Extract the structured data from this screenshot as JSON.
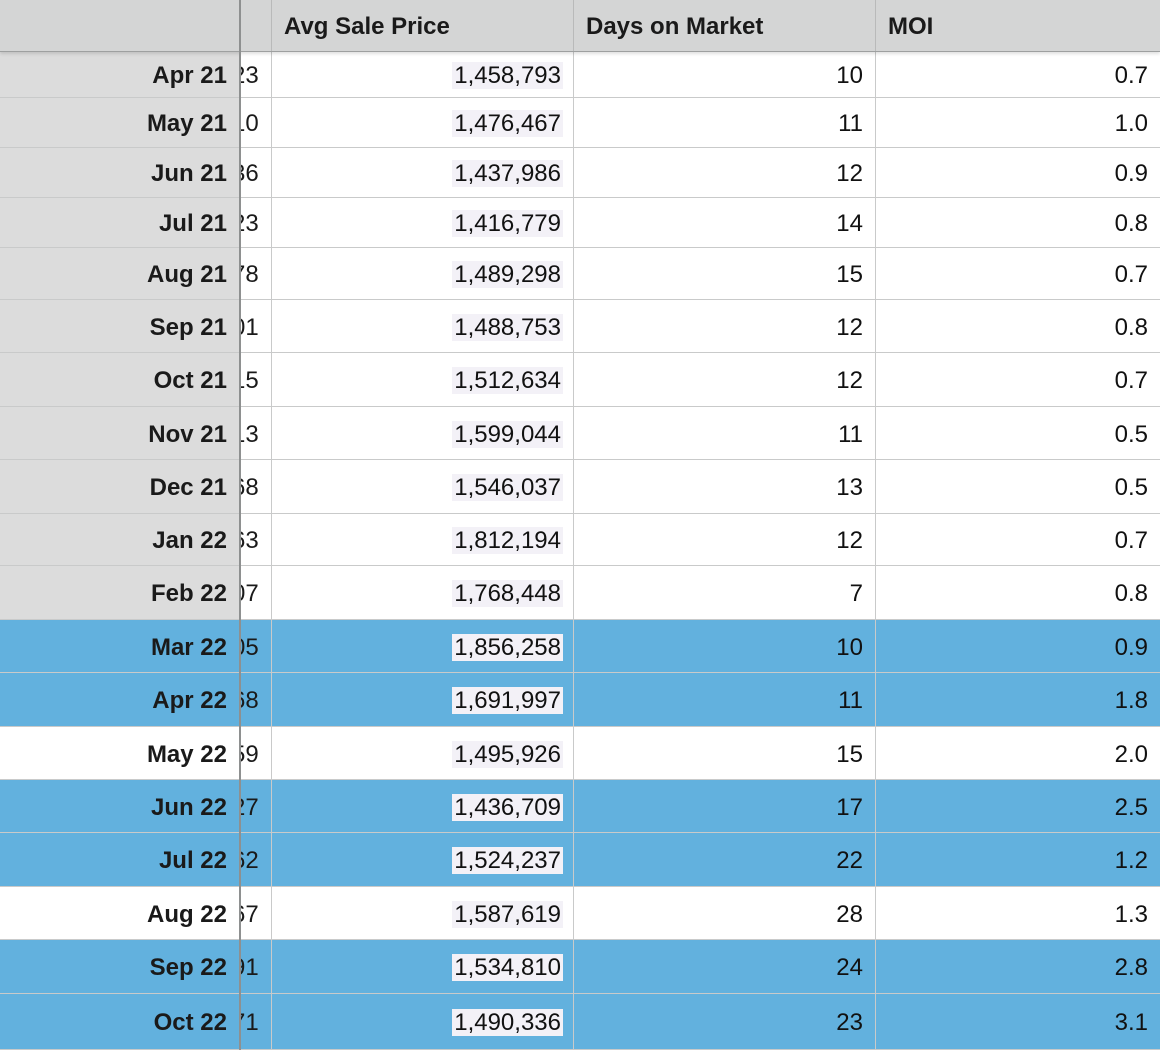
{
  "colors": {
    "header_bg": "#d4d5d5",
    "frozen_bg": "#dcdcdc",
    "highlight_blue": "#62b1de",
    "price_cell_bg": "#f3f1f7"
  },
  "header": {
    "col0": "",
    "col1": "",
    "col2": "Avg Sale Price",
    "col3": "Days on Market",
    "col4": "MOI"
  },
  "rows": [
    {
      "month": "Apr 21",
      "cut": "23",
      "price": "1,458,793",
      "dom": "10",
      "moi": "0.7",
      "style": "gray"
    },
    {
      "month": "May 21",
      "cut": "10",
      "price": "1,476,467",
      "dom": "11",
      "moi": "1.0",
      "style": "gray"
    },
    {
      "month": "Jun 21",
      "cut": "36",
      "price": "1,437,986",
      "dom": "12",
      "moi": "0.9",
      "style": "gray"
    },
    {
      "month": "Jul 21",
      "cut": "23",
      "price": "1,416,779",
      "dom": "14",
      "moi": "0.8",
      "style": "gray"
    },
    {
      "month": "Aug 21",
      "cut": "78",
      "price": "1,489,298",
      "dom": "15",
      "moi": "0.7",
      "style": "gray"
    },
    {
      "month": "Sep 21",
      "cut": "01",
      "price": "1,488,753",
      "dom": "12",
      "moi": "0.8",
      "style": "gray"
    },
    {
      "month": "Oct 21",
      "cut": "15",
      "price": "1,512,634",
      "dom": "12",
      "moi": "0.7",
      "style": "gray"
    },
    {
      "month": "Nov 21",
      "cut": "13",
      "price": "1,599,044",
      "dom": "11",
      "moi": "0.5",
      "style": "gray"
    },
    {
      "month": "Dec 21",
      "cut": "68",
      "price": "1,546,037",
      "dom": "13",
      "moi": "0.5",
      "style": "gray"
    },
    {
      "month": "Jan 22",
      "cut": "63",
      "price": "1,812,194",
      "dom": "12",
      "moi": "0.7",
      "style": "gray"
    },
    {
      "month": "Feb 22",
      "cut": "07",
      "price": "1,768,448",
      "dom": "7",
      "moi": "0.8",
      "style": "gray"
    },
    {
      "month": "Mar 22",
      "cut": "05",
      "price": "1,856,258",
      "dom": "10",
      "moi": "0.9",
      "style": "blue"
    },
    {
      "month": "Apr 22",
      "cut": "68",
      "price": "1,691,997",
      "dom": "11",
      "moi": "1.8",
      "style": "blue"
    },
    {
      "month": "May 22",
      "cut": "59",
      "price": "1,495,926",
      "dom": "15",
      "moi": "2.0",
      "style": "white"
    },
    {
      "month": "Jun 22",
      "cut": "27",
      "price": "1,436,709",
      "dom": "17",
      "moi": "2.5",
      "style": "blue"
    },
    {
      "month": "Jul 22",
      "cut": "62",
      "price": "1,524,237",
      "dom": "22",
      "moi": "1.2",
      "style": "blue"
    },
    {
      "month": "Aug 22",
      "cut": "67",
      "price": "1,587,619",
      "dom": "28",
      "moi": "1.3",
      "style": "white"
    },
    {
      "month": "Sep 22",
      "cut": "91",
      "price": "1,534,810",
      "dom": "24",
      "moi": "2.8",
      "style": "blue"
    },
    {
      "month": "Oct 22",
      "cut": "71",
      "price": "1,490,336",
      "dom": "23",
      "moi": "3.1",
      "style": "blue"
    }
  ]
}
